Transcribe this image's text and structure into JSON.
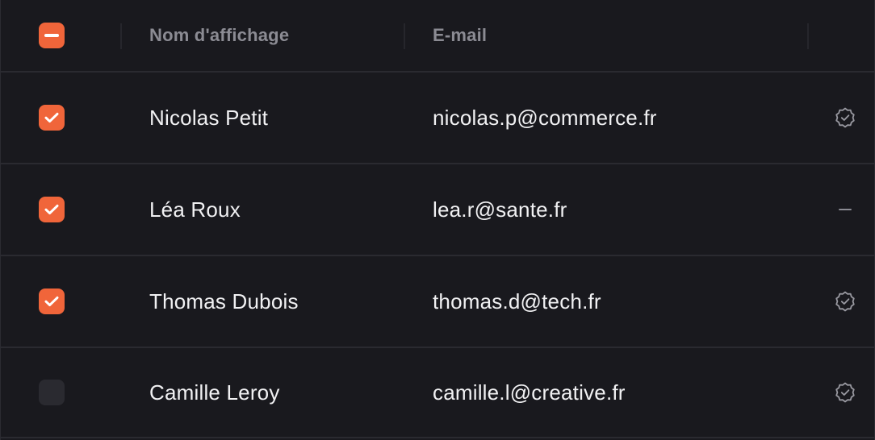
{
  "header": {
    "select_all_state": "indeterminate",
    "col_name": "Nom d'affichage",
    "col_email": "E-mail"
  },
  "rows": [
    {
      "name": "Nicolas Petit",
      "email": "nicolas.p@commerce.fr",
      "selected": true,
      "status": "verified-icon"
    },
    {
      "name": "Léa Roux",
      "email": "lea.r@sante.fr",
      "selected": true,
      "status": "dash-icon"
    },
    {
      "name": "Thomas Dubois",
      "email": "thomas.d@tech.fr",
      "selected": true,
      "status": "verified-icon"
    },
    {
      "name": "Camille Leroy",
      "email": "camille.l@creative.fr",
      "selected": false,
      "status": "verified-icon"
    }
  ],
  "colors": {
    "background": "#19191e",
    "accent": "#f0653a",
    "header_text": "#8b8b93",
    "row_text": "#f1f1f3",
    "divider": "#2a2a30"
  }
}
